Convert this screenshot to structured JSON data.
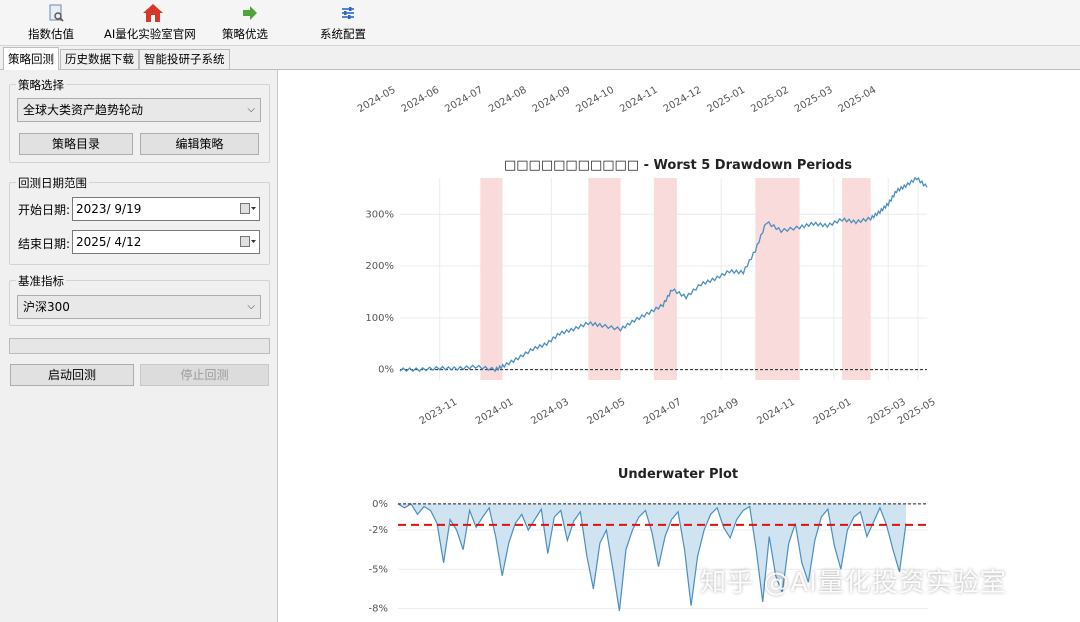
{
  "toolbar": {
    "items": [
      {
        "label": "指数估值",
        "icon": "index-valuation-icon"
      },
      {
        "label": "AI量化实验室官网",
        "icon": "home-icon"
      },
      {
        "label": "策略优选",
        "icon": "arrow-right-icon"
      },
      {
        "label": "系统配置",
        "icon": "settings-sliders-icon"
      }
    ]
  },
  "tabs": [
    "策略回测",
    "历史数据下载",
    "智能投研子系统"
  ],
  "strategy": {
    "group_title": "策略选择",
    "selected": "全球大类资产趋势轮动",
    "catalog_button": "策略目录",
    "edit_button": "编辑策略"
  },
  "dates": {
    "group_title": "回测日期范围",
    "start_label": "开始日期:",
    "start_value": "2023/  9/19",
    "end_label": "结束日期:",
    "end_value": "2025/  4/12"
  },
  "benchmark": {
    "group_title": "基准指标",
    "selected": "沪深300"
  },
  "progress": {
    "value": 0
  },
  "actions": {
    "start": "启动回测",
    "stop": "停止回测"
  },
  "colors": {
    "line": "#4a8fc0",
    "shade": "#fadbdb",
    "dd_mean": "#e01010",
    "fill": "#cfe3f1"
  },
  "chart_data": [
    {
      "type": "line",
      "description": "top x-axis ticks of previous chart (cut off)",
      "x_ticks": [
        "2024-05",
        "2024-06",
        "2024-07",
        "2024-08",
        "2024-09",
        "2024-10",
        "2024-11",
        "2024-12",
        "2025-01",
        "2025-02",
        "2025-03",
        "2025-04"
      ]
    },
    {
      "type": "line",
      "title": "□□□□□□□□□□□ - Worst 5 Drawdown Periods",
      "x_ticks": [
        "2023-11",
        "2024-01",
        "2024-03",
        "2024-05",
        "2024-07",
        "2024-09",
        "2024-11",
        "2025-01",
        "2025-03",
        "2025-05"
      ],
      "y_ticks": [
        "0%",
        "100%",
        "200%",
        "300%"
      ],
      "ylim": [
        -20,
        370
      ],
      "xlim": [
        "2023-09-19",
        "2025-04-12"
      ],
      "drawdown_periods": [
        [
          "2023-12-15",
          "2024-01-08"
        ],
        [
          "2024-04-10",
          "2024-05-15"
        ],
        [
          "2024-06-20",
          "2024-07-15"
        ],
        [
          "2024-10-08",
          "2024-11-25"
        ],
        [
          "2025-01-10",
          "2025-02-10"
        ]
      ],
      "series": [
        {
          "x": [
            "2023-09-19",
            "2023-10-10",
            "2023-11-01",
            "2023-11-20",
            "2023-12-10",
            "2023-12-31",
            "2024-01-10",
            "2024-01-25",
            "2024-02-10",
            "2024-02-25",
            "2024-03-10",
            "2024-03-25",
            "2024-04-10",
            "2024-04-25",
            "2024-05-15",
            "2024-05-30",
            "2024-06-15",
            "2024-06-30",
            "2024-07-10",
            "2024-07-25",
            "2024-08-10",
            "2024-08-25",
            "2024-09-10",
            "2024-09-25",
            "2024-10-08",
            "2024-10-20",
            "2024-11-05",
            "2024-11-25",
            "2024-12-10",
            "2024-12-25",
            "2025-01-10",
            "2025-01-25",
            "2025-02-10",
            "2025-02-20",
            "2025-03-01",
            "2025-03-10",
            "2025-03-20",
            "2025-04-01",
            "2025-04-12"
          ],
          "y": [
            0,
            0,
            3,
            2,
            6,
            0,
            8,
            22,
            40,
            50,
            70,
            78,
            90,
            85,
            78,
            95,
            110,
            125,
            155,
            140,
            165,
            175,
            190,
            188,
            230,
            285,
            268,
            275,
            282,
            278,
            290,
            285,
            292,
            305,
            320,
            345,
            355,
            370,
            352
          ]
        }
      ]
    },
    {
      "type": "area",
      "title": "Underwater Plot",
      "y_ticks": [
        "0%",
        "-2%",
        "-5%",
        "-8%"
      ],
      "ylim": [
        -8.5,
        0.3
      ],
      "mean_drawdown": -1.6,
      "series": [
        {
          "y": [
            0,
            -0.3,
            0,
            -0.8,
            -0.2,
            -0.5,
            -1.5,
            -4.5,
            -1.2,
            -2,
            -3.5,
            -0.5,
            -1.8,
            -1,
            -0.3,
            -2.5,
            -5.5,
            -3,
            -1.5,
            -0.8,
            -2,
            -1.2,
            -0.4,
            -3.8,
            -1,
            -0.5,
            -2.8,
            -1.3,
            -0.6,
            -4,
            -6.5,
            -3,
            -2,
            -5,
            -8.2,
            -3.5,
            -2,
            -1,
            -0.5,
            -2.2,
            -4.8,
            -2.5,
            -1.2,
            -0.6,
            -3.5,
            -7.8,
            -4,
            -2,
            -0.8,
            -0.3,
            -1.8,
            -2.6,
            -1.2,
            -0.5,
            -0.2,
            -3.5,
            -7.5,
            -2.5,
            -5.5,
            -6.8,
            -3,
            -1.5,
            -4.5,
            -6,
            -2.8,
            -1,
            -0.4,
            -3.2,
            -5,
            -2,
            -1,
            -0.6,
            -2.5,
            -1.4,
            -0.3,
            -1.6,
            -3.5,
            -5.2,
            -1.5
          ]
        }
      ]
    }
  ],
  "watermark": "知乎 @AI量化投资实验室"
}
